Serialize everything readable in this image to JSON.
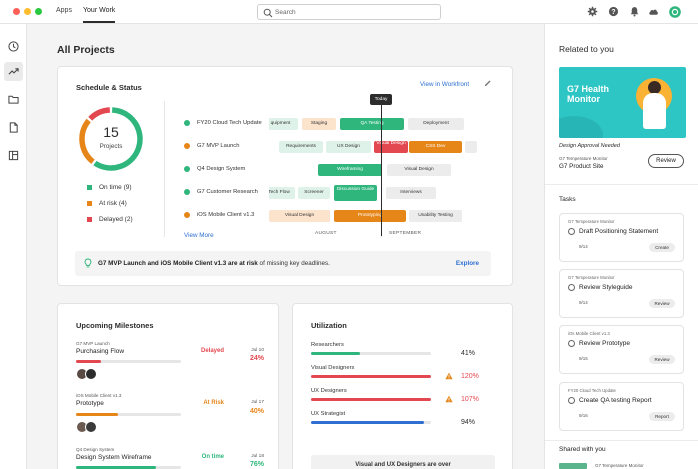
{
  "topbar": {
    "nav": [
      "Apps",
      "Your Work"
    ],
    "search_placeholder": "Search",
    "colors": {
      "close": "#fe5f57",
      "minimize": "#febc2e",
      "zoom": "#28c840"
    }
  },
  "page": {
    "title": "All Projects"
  },
  "schedule": {
    "title": "Schedule & Status",
    "view_link": "View in Workfront",
    "total": "15",
    "total_label": "Projects",
    "legend": [
      {
        "label": "On time",
        "count": "(9)",
        "color": "#2eb67d"
      },
      {
        "label": "At risk",
        "count": "(4)",
        "color": "#e68619"
      },
      {
        "label": "Delayed",
        "count": "(2)",
        "color": "#e34850"
      }
    ],
    "projects": [
      {
        "name": "FY20 Cloud Tech Update",
        "color": "#2eb67d"
      },
      {
        "name": "G7 MVP Launch",
        "color": "#e68619"
      },
      {
        "name": "Q4 Design System",
        "color": "#2eb67d"
      },
      {
        "name": "G7 Customer Research",
        "color": "#2eb67d"
      },
      {
        "name": "iOS Mobile Client v1.3",
        "color": "#e68619"
      }
    ],
    "bars": [
      [
        "quipment",
        "Staging",
        "QA Testing",
        "Deployment"
      ],
      [
        "Requirements",
        "UX Design",
        "Visual Design",
        "CSS Dev"
      ],
      [
        "Wireframing",
        "Visual Design"
      ],
      [
        "Tech Flow",
        "Screener",
        "Discussion Guide",
        "Interviews"
      ],
      [
        "Visual Design",
        "Prototyping",
        "Usability Testing"
      ]
    ],
    "today_label": "Today",
    "months": [
      "AUGUST",
      "SEPTEMBER"
    ],
    "view_more": "View More",
    "alert": {
      "bold": "G7 MVP Launch and iOS Mobile Client v1.3 are at risk",
      "rest": " of missing key deadlines.",
      "action": "Explore"
    }
  },
  "milestones": {
    "title": "Upcoming Milestones",
    "items": [
      {
        "project": "G7 MVP Launch",
        "name": "Purchasing Flow",
        "status": "Delayed",
        "status_color": "#e34850",
        "date": "Jul 10",
        "pct": "24%",
        "progress": 0.24
      },
      {
        "project": "iOS Mobile Client v1.3",
        "name": "Prototype",
        "status": "At Risk",
        "status_color": "#e68619",
        "date": "Jul 17",
        "pct": "40%",
        "progress": 0.4
      },
      {
        "project": "Q4 Design System",
        "name": "Design System Wireframe",
        "status": "On time",
        "status_color": "#2eb67d",
        "date": "Jul 18",
        "pct": "76%",
        "progress": 0.76
      }
    ]
  },
  "utilization": {
    "title": "Utilization",
    "items": [
      {
        "label": "Researchers",
        "value": "41%",
        "progress": 0.41,
        "color": "#2eb67d",
        "warn": false
      },
      {
        "label": "Visual Designers",
        "value": "120%",
        "progress": 1.0,
        "color": "#e34850",
        "warn": true
      },
      {
        "label": "UX Designers",
        "value": "107%",
        "progress": 1.0,
        "color": "#e34850",
        "warn": true
      },
      {
        "label": "UX Strategist",
        "value": "94%",
        "progress": 0.94,
        "color": "#2e6fd1",
        "warn": false
      }
    ],
    "note": "Visual and UX Designers are over"
  },
  "related": {
    "title": "Related to you",
    "banner_title": "G7 Health Monitor",
    "caption": "Design Approval Needed",
    "project": "G7 Temperature Monitor",
    "site": "G7 Product Site",
    "review": "Review"
  },
  "tasks": {
    "title": "Tasks",
    "items": [
      {
        "project": "G7 Temperature Monitor",
        "name": "Draft Positioning Statement",
        "date": "9/14",
        "action": "Create"
      },
      {
        "project": "G7 Temperature Monitor",
        "name": "Review Styleguide",
        "date": "9/14",
        "action": "Review"
      },
      {
        "project": "iOs Mobile Client v1.3",
        "name": "Review Prototype",
        "date": "9/15",
        "action": "Review"
      },
      {
        "project": "FY20 Cloud Tech Update",
        "name": "Create QA testing Report",
        "date": "9/16",
        "action": "Report"
      }
    ]
  },
  "shared": {
    "title": "Shared with you",
    "project": "G7 Temperature Monitor"
  }
}
